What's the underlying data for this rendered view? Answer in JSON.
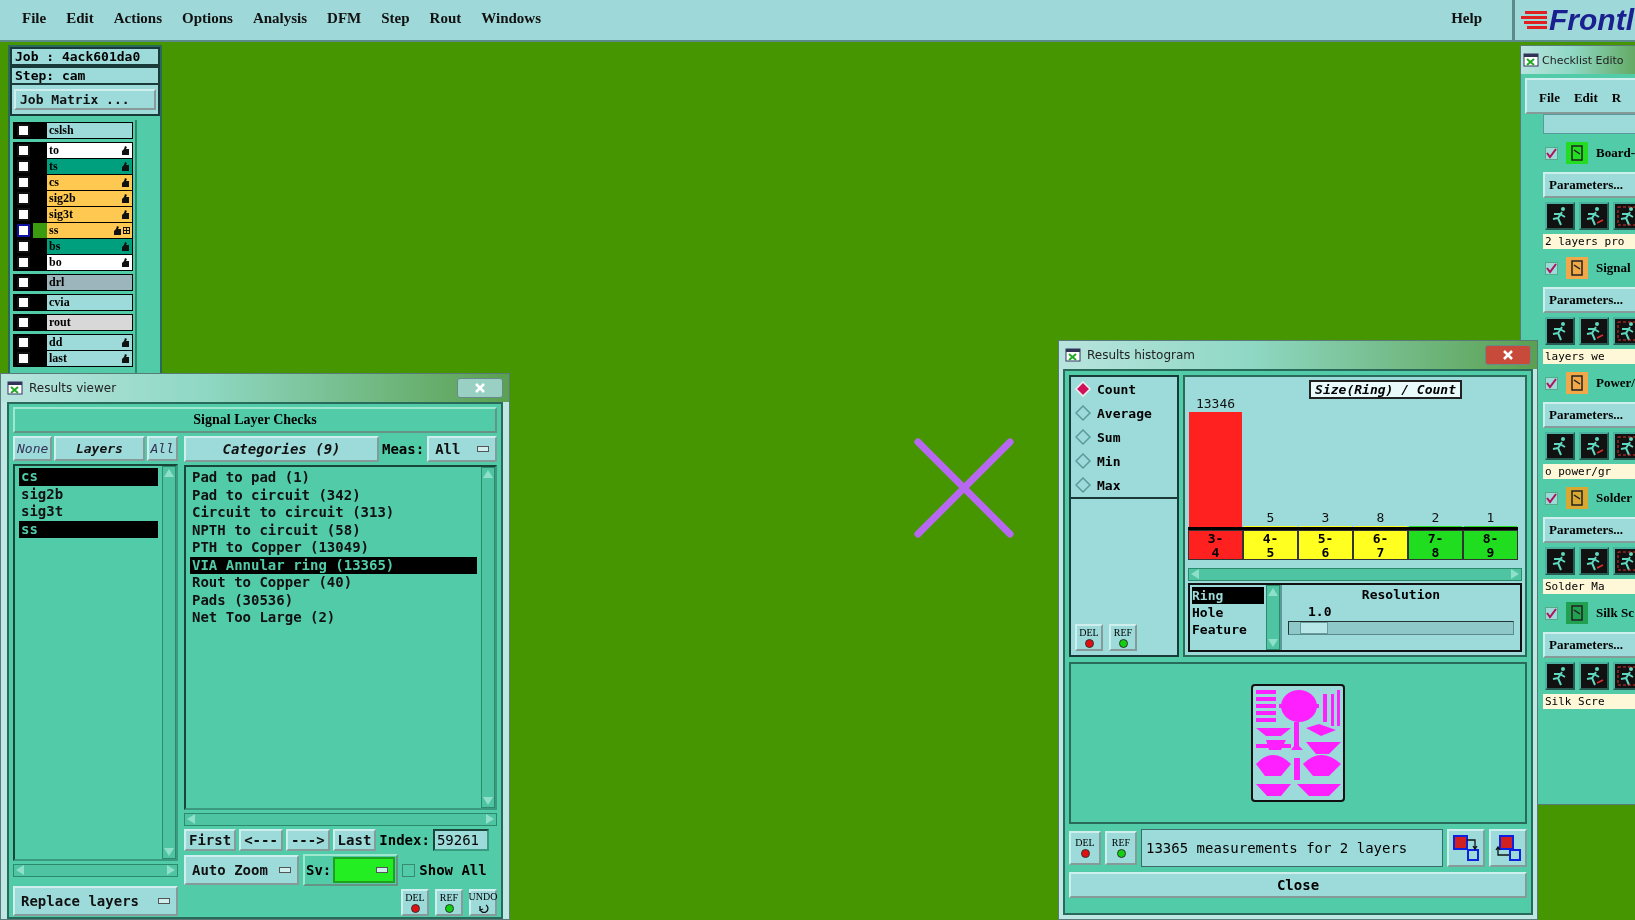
{
  "menu_bar": {
    "items": [
      "File",
      "Edit",
      "Actions",
      "Options",
      "Analysis",
      "DFM",
      "Step",
      "Rout",
      "Windows"
    ],
    "help": "Help"
  },
  "logo": {
    "text": "Frontl"
  },
  "job_panel": {
    "job": "Job : 4ack601da0",
    "step": "Step: cam",
    "matrix_button": "Job Matrix ...",
    "layer_groups": [
      {
        "layers": [
          {
            "name": "cslsh",
            "color": "#9ddada",
            "checked": false,
            "affected": false,
            "work": false
          }
        ]
      },
      {
        "layers": [
          {
            "name": "to",
            "color": "#ffffff",
            "checked": false,
            "affected": true,
            "work": false
          },
          {
            "name": "ts",
            "color": "#00a07e",
            "checked": false,
            "affected": true,
            "work": false
          },
          {
            "name": "cs",
            "color": "#ffc850",
            "checked": false,
            "affected": true,
            "work": false
          },
          {
            "name": "sig2b",
            "color": "#ffc850",
            "checked": false,
            "affected": true,
            "work": false
          },
          {
            "name": "sig3t",
            "color": "#ffc850",
            "checked": false,
            "affected": true,
            "work": false
          },
          {
            "name": "ss",
            "color": "#ffc850",
            "checked": false,
            "affected": true,
            "work": true
          },
          {
            "name": "bs",
            "color": "#00a07e",
            "checked": false,
            "affected": true,
            "work": false
          },
          {
            "name": "bo",
            "color": "#ffffff",
            "checked": false,
            "affected": true,
            "work": false
          }
        ]
      },
      {
        "layers": [
          {
            "name": "drl",
            "color": "#9cb4bc",
            "checked": false,
            "affected": false,
            "work": false
          }
        ]
      },
      {
        "layers": [
          {
            "name": "cvia",
            "color": "#9ddada",
            "checked": false,
            "affected": false,
            "work": false
          }
        ]
      },
      {
        "layers": [
          {
            "name": "rout",
            "color": "#d8d8d8",
            "checked": false,
            "affected": false,
            "work": false
          }
        ]
      },
      {
        "layers": [
          {
            "name": "dd",
            "color": "#9ddada",
            "checked": false,
            "affected": true,
            "work": false
          },
          {
            "name": "last",
            "color": "#9ddada",
            "checked": false,
            "affected": true,
            "work": false
          }
        ]
      }
    ]
  },
  "results_viewer": {
    "title": "Results viewer",
    "header": "Signal Layer Checks",
    "layer_buttons": [
      {
        "label": "None",
        "kind": "plain"
      },
      {
        "label": "Layers",
        "kind": "heading"
      },
      {
        "label": "All",
        "kind": "plain"
      }
    ],
    "layers": [
      {
        "name": "cs",
        "selected": true
      },
      {
        "name": "sig2b",
        "selected": false
      },
      {
        "name": "sig3t",
        "selected": false
      },
      {
        "name": "ss",
        "selected": true
      }
    ],
    "categories_heading": "Categories (9)",
    "meas_label": "Meas:",
    "meas_value": "All",
    "categories": [
      {
        "label": "Pad to pad (1)",
        "selected": false
      },
      {
        "label": "Pad to circuit (342)",
        "selected": false
      },
      {
        "label": "Circuit to circuit (313)",
        "selected": false
      },
      {
        "label": "NPTH to circuit (58)",
        "selected": false
      },
      {
        "label": "PTH to Copper (13049)",
        "selected": false
      },
      {
        "label": "VIA Annular ring (13365)",
        "selected": true
      },
      {
        "label": "Rout to Copper (40)",
        "selected": false
      },
      {
        "label": "Pads (30536)",
        "selected": false
      },
      {
        "label": "Net Too Large (2)",
        "selected": false
      }
    ],
    "nav_buttons": [
      "First",
      "<---",
      "--->",
      "Last"
    ],
    "index_label": "Index:",
    "index_value": "59261",
    "zoom_mode": "Auto Zoom",
    "sv": {
      "label": "Sv:",
      "color": "#22ee22"
    },
    "show_all": {
      "label": "Show All",
      "checked": false
    },
    "replace_mode": "Replace layers",
    "tool_buttons": [
      {
        "label": "DEL",
        "kind": "dot",
        "color": "#e01010"
      },
      {
        "label": "REF",
        "kind": "dot",
        "color": "#10d010"
      },
      {
        "label": "UNDO",
        "kind": "undo"
      }
    ]
  },
  "results_histogram": {
    "title": "Results histogram",
    "modes": [
      {
        "label": "Count",
        "selected": true
      },
      {
        "label": "Average",
        "selected": false
      },
      {
        "label": "Sum",
        "selected": false
      },
      {
        "label": "Min",
        "selected": false
      },
      {
        "label": "Max",
        "selected": false
      }
    ],
    "tool_buttons": [
      {
        "label": "DEL",
        "kind": "dot",
        "color": "#e01010"
      },
      {
        "label": "REF",
        "kind": "dot",
        "color": "#10d010"
      }
    ],
    "chart_data": {
      "type": "bar",
      "title": "Size(Ring) / Count",
      "categories": [
        "3-4",
        "4-5",
        "5-6",
        "6-7",
        "7-8",
        "8-9"
      ],
      "series": [
        {
          "values": [
            13346,
            5,
            3,
            8,
            2,
            1
          ]
        }
      ],
      "data_labels": true
    },
    "bins": [
      {
        "color": "#ff2020"
      },
      {
        "color": "#ffff20"
      },
      {
        "color": "#ffff20"
      },
      {
        "color": "#ffff20"
      },
      {
        "color": "#20dd20"
      },
      {
        "color": "#20dd20"
      }
    ],
    "measures": [
      {
        "label": "Ring",
        "selected": true
      },
      {
        "label": "Hole",
        "selected": false
      },
      {
        "label": "Feature",
        "selected": false
      }
    ],
    "resolution_label": "Resolution",
    "resolution_value": "1.0",
    "resolution": {
      "level": 0.05
    },
    "status_tool_buttons": [
      {
        "label": "DEL",
        "kind": "dot",
        "color": "#e01010"
      },
      {
        "label": "REF",
        "kind": "dot",
        "color": "#10d010"
      }
    ],
    "status": "13365 measurements for 2 layers",
    "close": "Close"
  },
  "checklist_editor": {
    "title": "Checklist Edito",
    "menu": [
      "File",
      "Edit",
      "R"
    ],
    "checks": [
      {
        "name": "Board-",
        "checked": true,
        "color": "#22dd22",
        "parameters": "Parameters...",
        "message": "2 layers pro"
      },
      {
        "name": "Signal",
        "checked": true,
        "color": "#f0a848",
        "parameters": "Parameters...",
        "message": "layers we"
      },
      {
        "name": "Power/",
        "checked": true,
        "color": "#f0a848",
        "parameters": "Parameters...",
        "message": "o power/gr"
      },
      {
        "name": "Solder",
        "checked": true,
        "color": "#d8a830",
        "parameters": "Parameters...",
        "message": "Solder Ma"
      },
      {
        "name": "Silk Sc",
        "checked": true,
        "color": "#20a050",
        "parameters": "Parameters...",
        "message": "Silk Scre"
      }
    ]
  }
}
